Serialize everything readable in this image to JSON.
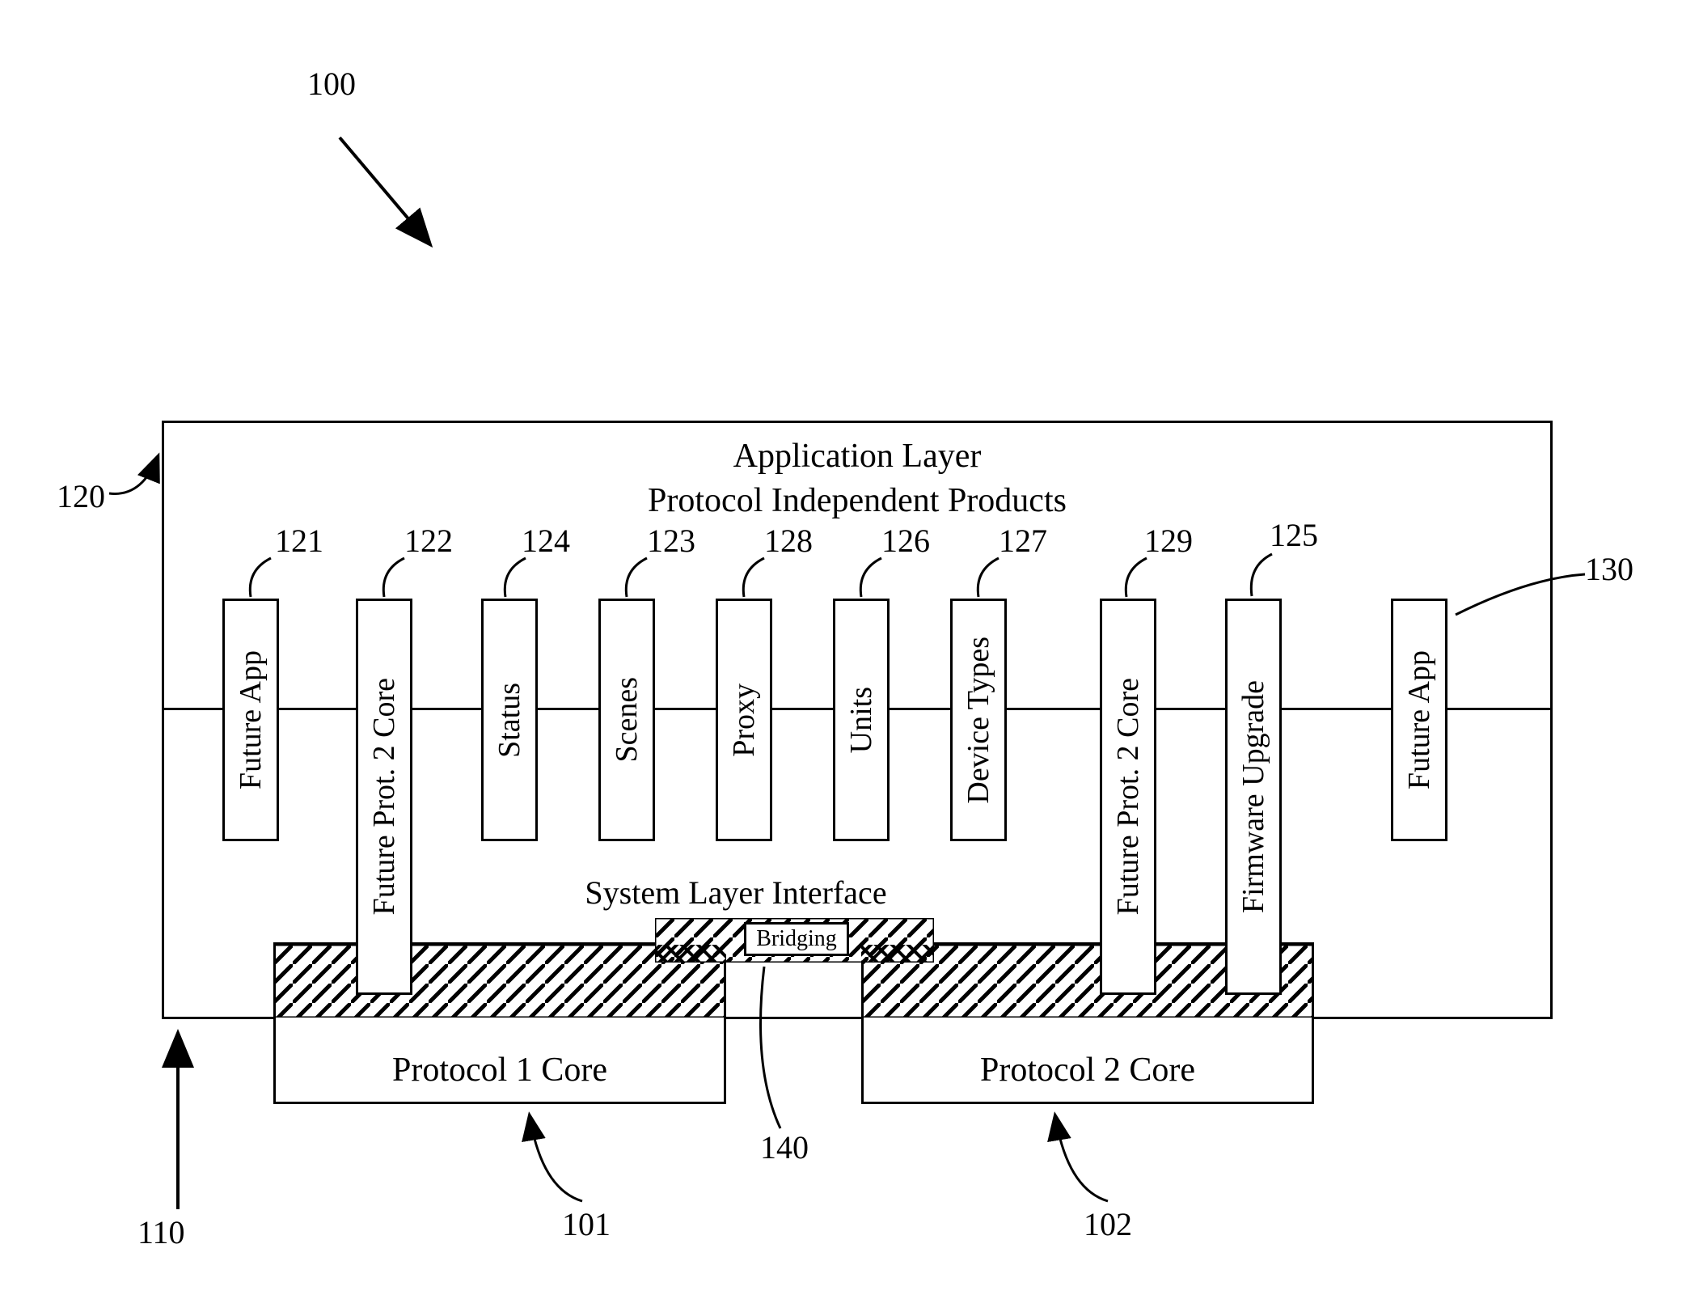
{
  "refs": {
    "r100": "100",
    "r120": "120",
    "r110": "110",
    "r101": "101",
    "r102": "102",
    "r140": "140",
    "r130": "130",
    "r121": "121",
    "r122": "122",
    "r124": "124",
    "r123": "123",
    "r128": "128",
    "r126": "126",
    "r127": "127",
    "r129": "129",
    "r125": "125"
  },
  "titles": {
    "line1": "Application Layer",
    "line2": "Protocol Independent Products",
    "syslayer": "System Layer Interface"
  },
  "boxes": {
    "b1": "Future App",
    "b2": "Future Prot. 2 Core",
    "b3": "Status",
    "b4": "Scenes",
    "b5": "Proxy",
    "b6": "Units",
    "b7": "Device Types",
    "b8": "Future Prot. 2 Core",
    "b9": "Firmware Upgrade",
    "b10": "Future App"
  },
  "bridging": "Bridging",
  "protocols": {
    "p1": "Protocol 1 Core",
    "p2": "Protocol 2 Core"
  }
}
